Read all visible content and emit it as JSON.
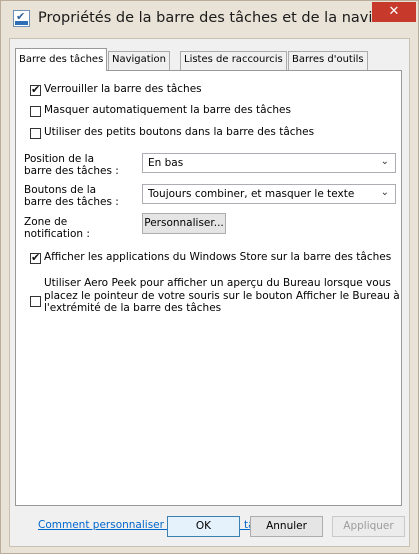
{
  "window": {
    "title": "Propriétés de la barre des tâches et de la navigati...",
    "close_symbol": "✕"
  },
  "tabs": [
    {
      "label": "Barre des tâches",
      "active": true
    },
    {
      "label": "Navigation",
      "active": false
    },
    {
      "label": "Listes de raccourcis",
      "active": false
    },
    {
      "label": "Barres d'outils",
      "active": false
    }
  ],
  "options": {
    "lock_taskbar": {
      "label": "Verrouiller la barre des tâches",
      "checked": true
    },
    "autohide": {
      "label": "Masquer automatiquement la barre des tâches",
      "checked": false
    },
    "small_buttons": {
      "label": "Utiliser des petits boutons dans la barre des tâches",
      "checked": false
    }
  },
  "settings": {
    "position_label": "Position de la barre des tâches :",
    "position_value": "En bas",
    "buttons_label": "Boutons de la barre des tâches :",
    "buttons_value": "Toujours combiner, et masquer le texte",
    "notification_label": "Zone de notification :",
    "customize_button": "Personnaliser..."
  },
  "more_options": {
    "store_apps": {
      "label": "Afficher les applications du Windows Store sur la barre des tâches",
      "checked": true
    },
    "aero_peek": {
      "label": "Utiliser Aero Peek pour afficher un aperçu du Bureau lorsque vous placez le pointeur de votre souris sur le bouton Afficher le Bureau à l'extrémité de la barre des tâches",
      "checked": false,
      "lines": [
        "Utiliser Aero Peek pour afficher un aperçu du Bureau lorsque vous",
        "placez le pointeur de votre souris sur le bouton Afficher le Bureau à",
        "l'extrémité de la barre des tâches"
      ]
    }
  },
  "help_link": "Comment personnaliser les barres des tâches ?",
  "footer": {
    "ok": "OK",
    "cancel": "Annuler",
    "apply": "Appliquer"
  },
  "icons": {
    "app": "taskbar-properties-icon",
    "dropdown": "chevron-down-icon",
    "close": "close-icon"
  },
  "colors": {
    "close_button": "#c7392b",
    "window_frame": "#e9e2d6",
    "link": "#0066cc"
  }
}
